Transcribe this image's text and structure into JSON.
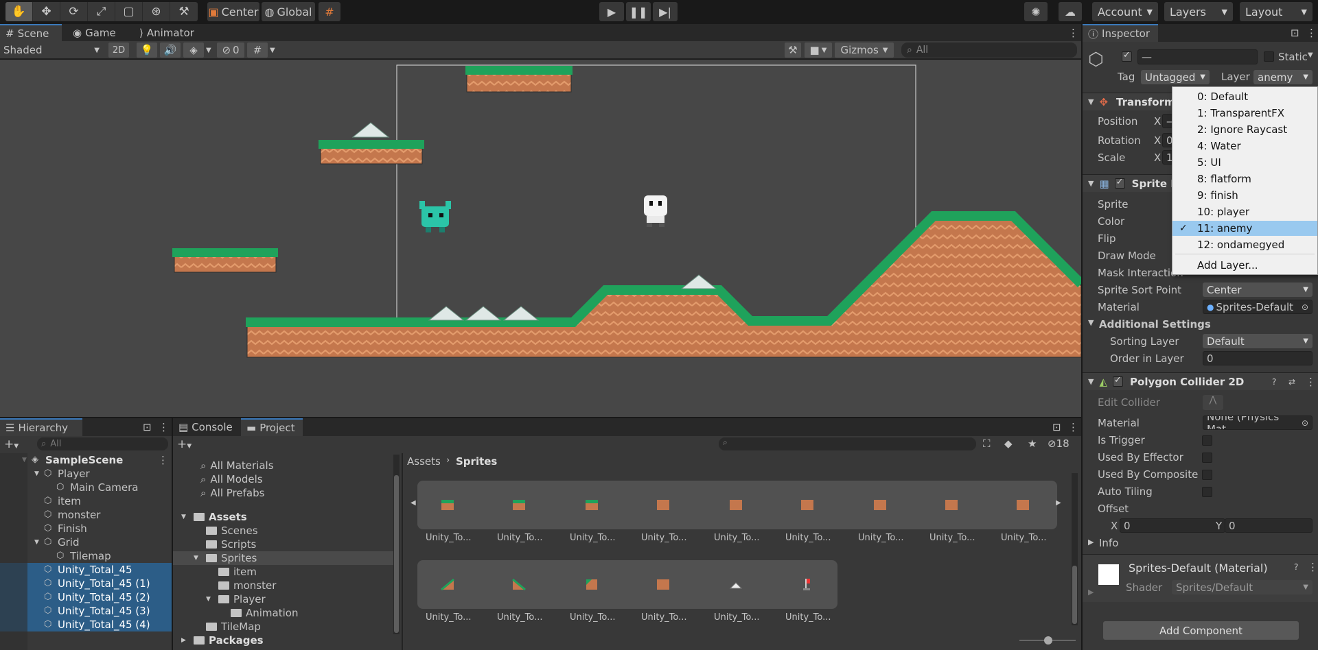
{
  "toolbar": {
    "pivot": "Center",
    "space": "Global",
    "account": "Account",
    "layers": "Layers",
    "layout": "Layout"
  },
  "scene_tabs": [
    "Scene",
    "Game",
    "Animator"
  ],
  "scene_toolbar": {
    "shading": "Shaded",
    "mode2d": "2D",
    "hidden_count": "0",
    "gizmos": "Gizmos",
    "search_placeholder": "All"
  },
  "inspector": {
    "tab": "Inspector",
    "object_name": "—",
    "static": "Static",
    "tag_label": "Tag",
    "tag_value": "Untagged",
    "layer_label": "Layer",
    "layer_value": "anemy",
    "transform": {
      "title": "Transform",
      "position": "Position",
      "rotation": "Rotation",
      "scale": "Scale",
      "x": "X",
      "pos_x": "—",
      "rot_x": "0",
      "scale_x": "1"
    },
    "sprite_renderer": {
      "title": "Sprite Renderer",
      "sprite": "Sprite",
      "color": "Color",
      "flip": "Flip",
      "draw_mode": "Draw Mode",
      "mask_interaction": "Mask Interaction",
      "sort_point_label": "Sprite Sort Point",
      "sort_point_value": "Center",
      "material_label": "Material",
      "material_value": "Sprites-Default",
      "additional": "Additional Settings",
      "sorting_layer_label": "Sorting Layer",
      "sorting_layer_value": "Default",
      "order_label": "Order in Layer",
      "order_value": "0"
    },
    "polygon": {
      "title": "Polygon Collider 2D",
      "edit_collider": "Edit Collider",
      "material_label": "Material",
      "material_value": "None (Physics Mat",
      "is_trigger": "Is Trigger",
      "used_by_effector": "Used By Effector",
      "used_by_composite": "Used By Composite",
      "auto_tiling": "Auto Tiling",
      "offset": "Offset",
      "x": "X",
      "x_value": "0",
      "y": "Y",
      "y_value": "0",
      "info": "Info"
    },
    "material_section": {
      "title": "Sprites-Default (Material)",
      "shader_label": "Shader",
      "shader_value": "Sprites/Default"
    },
    "add_component": "Add Component"
  },
  "layer_menu": {
    "items": [
      "0: Default",
      "1: TransparentFX",
      "2: Ignore Raycast",
      "4: Water",
      "5: UI",
      "8: flatform",
      "9: finish",
      "10: player",
      "11: anemy",
      "12: ondamegyed"
    ],
    "selected_index": 8,
    "add_layer": "Add Layer..."
  },
  "hierarchy": {
    "tab": "Hierarchy",
    "search_placeholder": "All",
    "items": [
      {
        "label": "SampleScene",
        "indent": 0,
        "bold": true,
        "selected": false
      },
      {
        "label": "Player",
        "indent": 1,
        "selected": false
      },
      {
        "label": "Main Camera",
        "indent": 2,
        "selected": false
      },
      {
        "label": "item",
        "indent": 1,
        "selected": false
      },
      {
        "label": "monster",
        "indent": 1,
        "selected": false
      },
      {
        "label": "Finish",
        "indent": 1,
        "selected": false
      },
      {
        "label": "Grid",
        "indent": 1,
        "selected": false
      },
      {
        "label": "Tilemap",
        "indent": 2,
        "selected": false
      },
      {
        "label": "Unity_Total_45",
        "indent": 1,
        "selected": true
      },
      {
        "label": "Unity_Total_45 (1)",
        "indent": 1,
        "selected": true
      },
      {
        "label": "Unity_Total_45 (2)",
        "indent": 1,
        "selected": true
      },
      {
        "label": "Unity_Total_45 (3)",
        "indent": 1,
        "selected": true
      },
      {
        "label": "Unity_Total_45 (4)",
        "indent": 1,
        "selected": true
      }
    ]
  },
  "project": {
    "tabs": [
      "Console",
      "Project"
    ],
    "hidden_count": "18",
    "favorites": [
      "All Materials",
      "All Models",
      "All Prefabs"
    ],
    "tree": [
      {
        "label": "Assets",
        "indent": 0,
        "bold": true
      },
      {
        "label": "Scenes",
        "indent": 1
      },
      {
        "label": "Scripts",
        "indent": 1
      },
      {
        "label": "Sprites",
        "indent": 1,
        "selected": true
      },
      {
        "label": "item",
        "indent": 2
      },
      {
        "label": "monster",
        "indent": 2
      },
      {
        "label": "Player",
        "indent": 2
      },
      {
        "label": "Animation",
        "indent": 3
      },
      {
        "label": "TileMap",
        "indent": 1
      },
      {
        "label": "Packages",
        "indent": 0,
        "bold": true
      }
    ],
    "breadcrumb": [
      "Assets",
      "Sprites"
    ],
    "asset_label": "Unity_To..."
  }
}
